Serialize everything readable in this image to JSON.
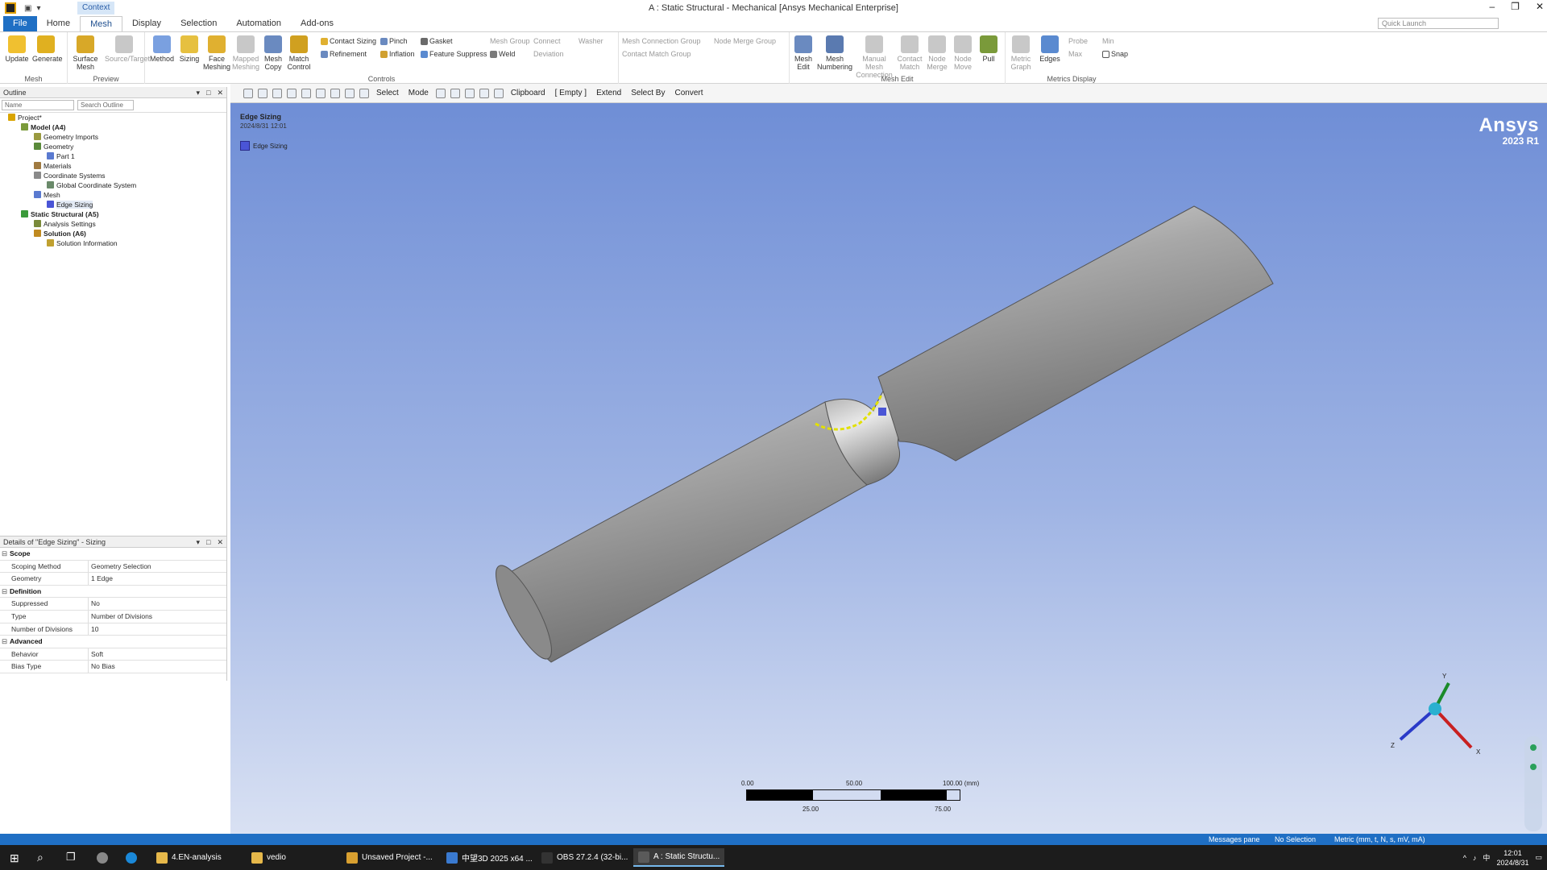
{
  "window": {
    "title": "A : Static Structural - Mechanical [Ansys Mechanical Enterprise]",
    "context_label": "Context",
    "quick_launch": "Quick Launch"
  },
  "tabs": [
    "File",
    "Home",
    "Mesh",
    "Display",
    "Selection",
    "Automation",
    "Add-ons"
  ],
  "ribbon": {
    "mesh_group": {
      "label": "Mesh",
      "update": "Update",
      "generate": "Generate"
    },
    "preview_group": {
      "label": "Preview",
      "surface_mesh": "Surface Mesh",
      "source_target": "Source/Target"
    },
    "controls_group": {
      "label": "Controls",
      "method": "Method",
      "sizing": "Sizing",
      "face_meshing": "Face Meshing",
      "mapped_meshing": "Mapped Meshing",
      "mesh_copy": "Mesh Copy",
      "match_control": "Match Control",
      "contact_sizing": "Contact Sizing",
      "refinement": "Refinement",
      "pinch": "Pinch",
      "inflation": "Inflation",
      "gasket": "Gasket",
      "feature_suppress": "Feature Suppress",
      "mesh_group": "Mesh Group",
      "weld": "Weld",
      "connect": "Connect",
      "deviation": "Deviation",
      "washer": "Washer"
    },
    "connection_group": {
      "mesh_connection_group": "Mesh Connection Group",
      "node_merge_group": "Node Merge Group",
      "contact_match_group": "Contact Match Group"
    },
    "mesh_edit_group": {
      "label": "Mesh Edit",
      "mesh_edit": "Mesh Edit",
      "mesh_numbering": "Mesh Numbering",
      "manual_mesh_connection": "Manual Mesh Connection",
      "contact_match": "Contact Match",
      "node_merge": "Node Merge",
      "node_move": "Node Move",
      "pull": "Pull"
    },
    "metrics_group": {
      "label": "Metrics Display",
      "metric_graph": "Metric Graph",
      "edges": "Edges",
      "probe": "Probe",
      "min": "Min",
      "max": "Max",
      "snap": "Snap"
    }
  },
  "graphics_toolbar": {
    "select": "Select",
    "mode": "Mode",
    "clipboard": "Clipboard",
    "empty": "[ Empty ]",
    "extend": "Extend",
    "select_by": "Select By",
    "convert": "Convert"
  },
  "outline": {
    "header": "Outline",
    "name_filter": "Name",
    "search_placeholder": "Search Outline",
    "tree": [
      {
        "label": "Project*",
        "level": 0,
        "bold": false,
        "color": "#d9a400"
      },
      {
        "label": "Model (A4)",
        "level": 1,
        "bold": true,
        "color": "#7a9a3a"
      },
      {
        "label": "Geometry Imports",
        "level": 2,
        "bold": false,
        "color": "#9a9a40"
      },
      {
        "label": "Geometry",
        "level": 2,
        "bold": false,
        "color": "#5a8a3a"
      },
      {
        "label": "Part 1",
        "level": 3,
        "bold": false,
        "color": "#5a7ad0"
      },
      {
        "label": "Materials",
        "level": 2,
        "bold": false,
        "color": "#a07a40"
      },
      {
        "label": "Coordinate Systems",
        "level": 2,
        "bold": false,
        "color": "#8a8a8a"
      },
      {
        "label": "Global Coordinate System",
        "level": 3,
        "bold": false,
        "color": "#6a8a6a"
      },
      {
        "label": "Mesh",
        "level": 2,
        "bold": false,
        "color": "#5a7ad0"
      },
      {
        "label": "Edge Sizing",
        "level": 3,
        "bold": false,
        "color": "#4a55d6",
        "selected": true
      },
      {
        "label": "Static Structural (A5)",
        "level": 1,
        "bold": true,
        "color": "#3a9a3a"
      },
      {
        "label": "Analysis Settings",
        "level": 2,
        "bold": false,
        "color": "#7a8a3a"
      },
      {
        "label": "Solution (A6)",
        "level": 2,
        "bold": true,
        "color": "#c08a20"
      },
      {
        "label": "Solution Information",
        "level": 3,
        "bold": false,
        "color": "#c0a030"
      }
    ]
  },
  "details": {
    "header": "Details of \"Edge Sizing\" - Sizing",
    "sections": [
      {
        "title": "Scope",
        "rows": [
          [
            "Scoping Method",
            "Geometry Selection"
          ],
          [
            "Geometry",
            "1 Edge"
          ]
        ]
      },
      {
        "title": "Definition",
        "rows": [
          [
            "Suppressed",
            "No"
          ],
          [
            "Type",
            "Number of Divisions"
          ],
          [
            "Number of Divisions",
            "10"
          ]
        ]
      },
      {
        "title": "Advanced",
        "rows": [
          [
            "Behavior",
            "Soft"
          ],
          [
            "Bias Type",
            "No Bias"
          ]
        ]
      }
    ]
  },
  "viewport": {
    "title": "Edge Sizing",
    "timestamp": "2024/8/31 12:01",
    "legend": "Edge Sizing",
    "brand": "Ansys",
    "version": "2023 R1",
    "scale_top": [
      "0.00",
      "50.00",
      "100.00 (mm)"
    ],
    "scale_bottom": [
      "25.00",
      "75.00"
    ],
    "axes": {
      "x": "X",
      "y": "Y",
      "z": "Z"
    }
  },
  "statusbar": {
    "messages": "Messages pane",
    "selection": "No Selection",
    "units": "Metric (mm, t, N, s, mV, mA)"
  },
  "taskbar": {
    "apps": [
      {
        "label": "4.EN-analysis",
        "color": "#e6b84a"
      },
      {
        "label": "vedio",
        "color": "#e6b84a"
      },
      {
        "label": "Unsaved Project -...",
        "color": "#d9a030"
      },
      {
        "label": "中望3D 2025 x64 ...",
        "color": "#3a7ad0"
      },
      {
        "label": "OBS 27.2.4 (32-bi...",
        "color": "#333333"
      },
      {
        "label": "A : Static Structu...",
        "color": "#5a5a5a",
        "active": true
      }
    ],
    "time": "12:01",
    "date": "2024/8/31"
  }
}
